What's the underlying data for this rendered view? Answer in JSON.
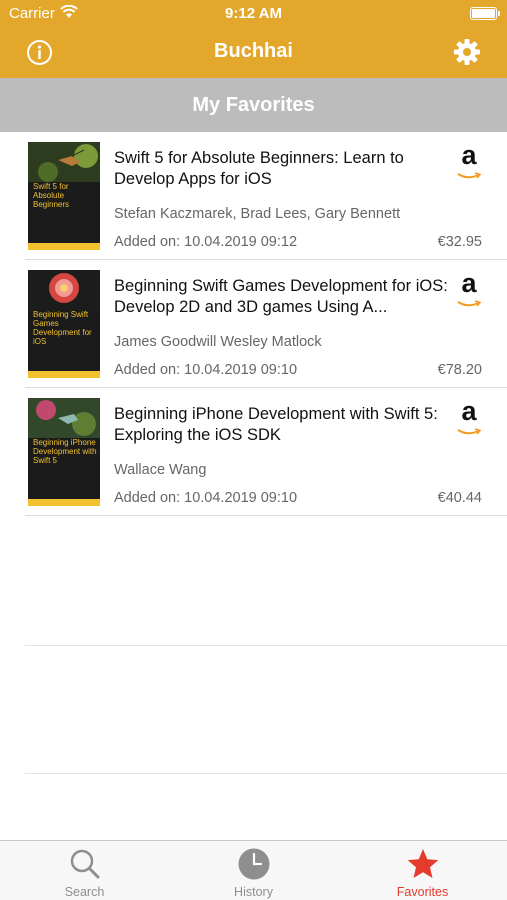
{
  "status_bar": {
    "carrier": "Carrier",
    "time": "9:12 AM"
  },
  "nav": {
    "title": "Buchhai",
    "left_icon": "info-icon",
    "right_icon": "gear-icon"
  },
  "section": {
    "title": "My Favorites"
  },
  "books": [
    {
      "title": "Swift 5 for Absolute Beginners: Learn to Develop Apps for iOS",
      "authors": "Stefan Kaczmarek, Brad Lees, Gary Bennett",
      "added": "Added on: 10.04.2019 09:12",
      "price": "€32.95",
      "cover_title": "Swift 5 for Absolute Beginners",
      "store_icon": "amazon-icon"
    },
    {
      "title": "Beginning Swift Games Development for iOS: Develop 2D and 3D games Using A...",
      "authors": "James Goodwill Wesley Matlock",
      "added": "Added on: 10.04.2019 09:10",
      "price": "€78.20",
      "cover_title": "Beginning Swift Games Development for iOS",
      "store_icon": "amazon-icon"
    },
    {
      "title": "Beginning iPhone Development with Swift 5: Exploring the iOS SDK",
      "authors": "Wallace Wang",
      "added": "Added on: 10.04.2019 09:10",
      "price": "€40.44",
      "cover_title": "Beginning iPhone Development with Swift 5",
      "store_icon": "amazon-icon"
    }
  ],
  "amazon_glyph": "a",
  "tabs": [
    {
      "label": "Search",
      "icon": "search-icon",
      "active": false
    },
    {
      "label": "History",
      "icon": "clock-icon",
      "active": false
    },
    {
      "label": "Favorites",
      "icon": "star-icon",
      "active": true
    }
  ],
  "colors": {
    "brand": "#e3a82b",
    "section": "#bcbcbc",
    "active_tab": "#e53b2c",
    "inactive_tab": "#8e8e8e"
  }
}
